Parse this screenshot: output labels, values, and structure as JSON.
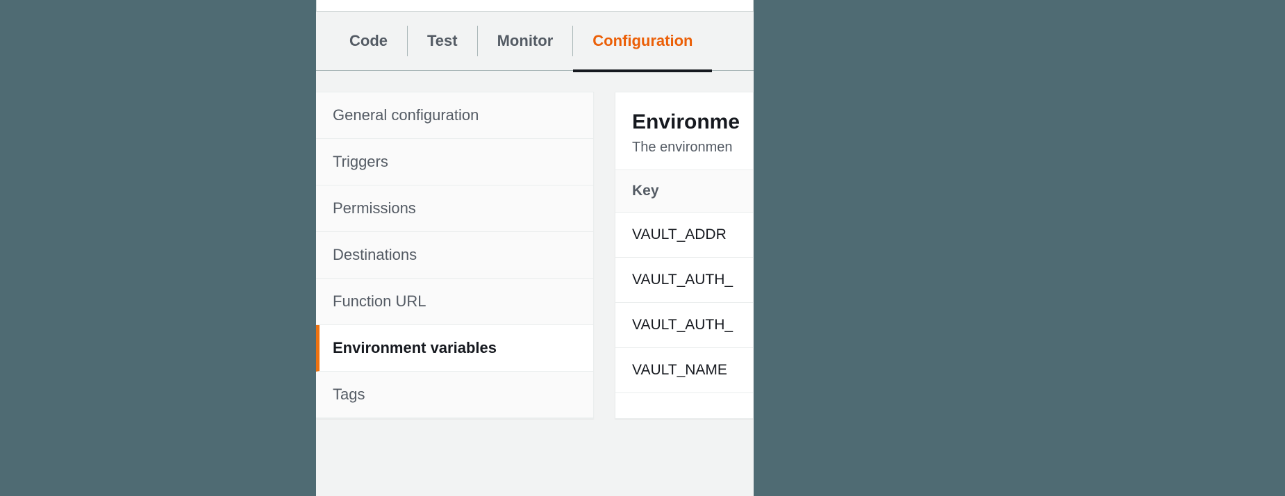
{
  "tabs": {
    "items": [
      {
        "label": "Code"
      },
      {
        "label": "Test"
      },
      {
        "label": "Monitor"
      },
      {
        "label": "Configuration"
      }
    ],
    "activeIndex": 3
  },
  "sidebar": {
    "items": [
      {
        "label": "General configuration"
      },
      {
        "label": "Triggers"
      },
      {
        "label": "Permissions"
      },
      {
        "label": "Destinations"
      },
      {
        "label": "Function URL"
      },
      {
        "label": "Environment variables"
      },
      {
        "label": "Tags"
      }
    ],
    "activeIndex": 5
  },
  "main": {
    "title": "Environme",
    "description": "The environmen",
    "table": {
      "header_key": "Key",
      "rows": [
        {
          "key": "VAULT_ADDR"
        },
        {
          "key": "VAULT_AUTH_"
        },
        {
          "key": "VAULT_AUTH_"
        },
        {
          "key": "VAULT_NAME"
        }
      ]
    }
  }
}
